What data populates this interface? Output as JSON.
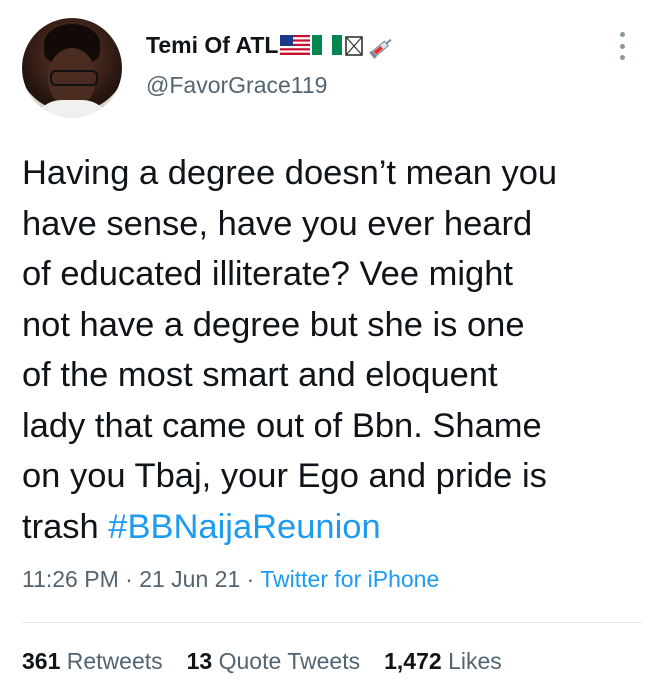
{
  "user": {
    "display_name": "Temi Of ATL",
    "flags": [
      "flag-us",
      "flag-nigeria",
      "flag-unknown",
      "syringe"
    ],
    "handle": "@FavorGrace119"
  },
  "tweet": {
    "text": "Having a degree doesn’t mean you\nhave sense, have you ever heard\nof educated illiterate? Vee might\nnot have a degree but she is one\nof the most smart and eloquent\nlady that came out of Bbn. Shame\non you Tbaj, your Ego and pride is\ntrash ",
    "hashtag": "#BBNaijaReunion",
    "time": "11:26 PM",
    "date": "21 Jun 21",
    "separator": " · ",
    "source": "Twitter for iPhone"
  },
  "stats": {
    "retweets_count": "361",
    "retweets_label": " Retweets",
    "quotes_count": "13",
    "quotes_label": " Quote Tweets",
    "likes_count": "1,472",
    "likes_label": " Likes"
  },
  "colors": {
    "link": "#1d9bf0",
    "secondary_text": "#536471",
    "primary_text": "#0f1419"
  }
}
